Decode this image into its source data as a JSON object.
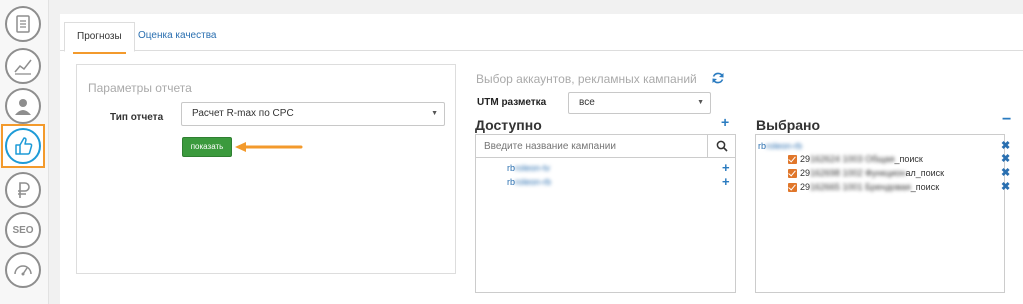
{
  "sidebar": {
    "items": [
      {
        "icon": "document-icon"
      },
      {
        "icon": "chart-icon"
      },
      {
        "icon": "user-icon"
      },
      {
        "icon": "thumbs-up-icon",
        "active": true
      },
      {
        "icon": "ruble-icon"
      },
      {
        "icon": "seo-icon",
        "text": "SEO"
      },
      {
        "icon": "gauge-icon"
      }
    ]
  },
  "tabs": [
    {
      "label": "Прогнозы",
      "active": true
    },
    {
      "label": "Оценка качества"
    }
  ],
  "params": {
    "title": "Параметры отчета",
    "report_type_label": "Тип отчета",
    "report_type_value": "Расчет R-max по CPC",
    "show_button": "показать"
  },
  "accounts": {
    "title": "Выбор аккаунтов, рекламных кампаний",
    "utm_label": "UTM разметка",
    "utm_value": "все",
    "available_title": "Доступно",
    "search_placeholder": "Введите название кампании",
    "available_items": [
      {
        "prefix": "rb",
        "rest": "roleon-tv"
      },
      {
        "prefix": "rb",
        "rest": "roleon-rb"
      }
    ],
    "selected_title": "Выбрано",
    "selected_root": {
      "prefix": "rb",
      "rest": "roleon-rb"
    },
    "selected_items": [
      {
        "lead": "29",
        "mid": "162624 1003 Общая",
        "tail": "_поиск"
      },
      {
        "lead": "29",
        "mid": "162698 1002 Функцион",
        "tail": "ал_поиск"
      },
      {
        "lead": "29",
        "mid": "162665 1001 Брендовая",
        "tail": "_поиск"
      }
    ]
  },
  "colors": {
    "accent_orange": "#f39a2c",
    "button_green": "#3b9a3d",
    "link_blue": "#2a6fb0",
    "active_icon_blue": "#1e9bd7"
  }
}
